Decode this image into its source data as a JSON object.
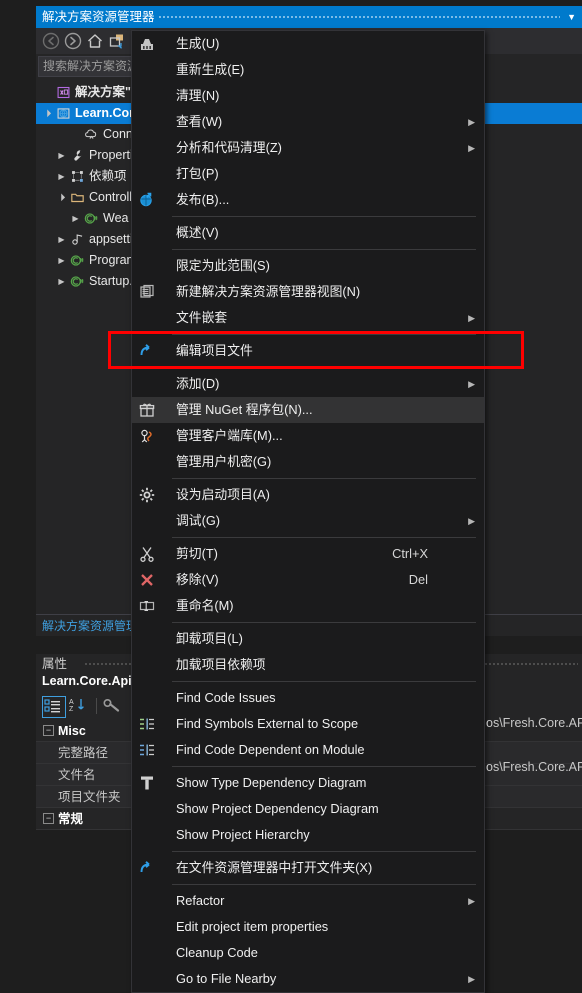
{
  "solution_explorer": {
    "title": "解决方案资源管理器",
    "dropdown_icon": "chevron-down-icon",
    "toolbar": [
      {
        "name": "back-icon",
        "label": "后退"
      },
      {
        "name": "forward-icon",
        "label": "前进"
      },
      {
        "name": "home-icon",
        "label": "主页"
      },
      {
        "name": "sync-with-active-document-icon",
        "label": "与活动文档同步"
      }
    ],
    "search": {
      "placeholder": "搜索解决方案资源管理器",
      "value": "搜索解决方案资源管理器"
    },
    "tree": [
      {
        "label": "解决方案\"Fresh",
        "icon": "solution-icon",
        "indent": 0,
        "twisty": "",
        "selected": false,
        "bold": true
      },
      {
        "label": "Learn.Core.Api",
        "icon": "web-project-icon",
        "indent": 0,
        "twisty": "▲",
        "selected": true,
        "bold": true
      },
      {
        "label": "Connected",
        "icon": "connected-services-icon",
        "indent": 2,
        "twisty": "",
        "selected": false,
        "bold": false
      },
      {
        "label": "Properties",
        "icon": "wrench-icon",
        "indent": 1,
        "twisty": "▶",
        "selected": false,
        "bold": false
      },
      {
        "label": "依赖项",
        "icon": "dependencies-icon",
        "indent": 1,
        "twisty": "▶",
        "selected": false,
        "bold": false
      },
      {
        "label": "Controllers",
        "icon": "folder-icon",
        "indent": 1,
        "twisty": "▲",
        "selected": false,
        "bold": false
      },
      {
        "label": "Wea",
        "icon": "csharp-icon",
        "indent": 2,
        "twisty": "▶",
        "selected": false,
        "bold": false
      },
      {
        "label": "appsettings.json",
        "icon": "json-icon",
        "indent": 1,
        "twisty": "▶",
        "selected": false,
        "bold": false
      },
      {
        "label": "Program.cs",
        "icon": "csharp-icon",
        "indent": 1,
        "twisty": "▶",
        "selected": false,
        "bold": false
      },
      {
        "label": "Startup.cs",
        "icon": "csharp-icon",
        "indent": 1,
        "twisty": "▶",
        "selected": false,
        "bold": false
      }
    ],
    "footer_tab": "解决方案资源管理器"
  },
  "properties": {
    "title": "属性",
    "subtitle": "Learn.Core.Api",
    "toolbar": [
      {
        "name": "categorized-icon",
        "label": "分类"
      },
      {
        "name": "alphabetical-sort-icon",
        "label": "按字母顺序"
      },
      {
        "name": "property-pages-icon",
        "label": "属性页"
      }
    ],
    "rows": [
      {
        "kind": "category",
        "name": "Misc",
        "value": ""
      },
      {
        "kind": "property",
        "name": "完整路径",
        "value": "os\\Fresh.Core.API"
      },
      {
        "kind": "property",
        "name": "文件名",
        "value": ""
      },
      {
        "kind": "property",
        "name": "项目文件夹",
        "value": "os\\Fresh.Core.API"
      },
      {
        "kind": "category",
        "name": "常规",
        "value": ""
      }
    ]
  },
  "context_menu": {
    "items": [
      {
        "type": "item",
        "label": "生成(U)",
        "icon": "build-icon",
        "shortcut": "",
        "submenu": false,
        "highlighted": false
      },
      {
        "type": "item",
        "label": "重新生成(E)",
        "icon": "",
        "shortcut": "",
        "submenu": false,
        "highlighted": false
      },
      {
        "type": "item",
        "label": "清理(N)",
        "icon": "",
        "shortcut": "",
        "submenu": false,
        "highlighted": false
      },
      {
        "type": "item",
        "label": "查看(W)",
        "icon": "",
        "shortcut": "",
        "submenu": true,
        "highlighted": false
      },
      {
        "type": "item",
        "label": "分析和代码清理(Z)",
        "icon": "",
        "shortcut": "",
        "submenu": true,
        "highlighted": false
      },
      {
        "type": "item",
        "label": "打包(P)",
        "icon": "",
        "shortcut": "",
        "submenu": false,
        "highlighted": false
      },
      {
        "type": "item",
        "label": "发布(B)...",
        "icon": "publish-icon",
        "shortcut": "",
        "submenu": false,
        "highlighted": false
      },
      {
        "type": "separator"
      },
      {
        "type": "item",
        "label": "概述(V)",
        "icon": "",
        "shortcut": "",
        "submenu": false,
        "highlighted": false
      },
      {
        "type": "separator"
      },
      {
        "type": "item",
        "label": "限定为此范围(S)",
        "icon": "",
        "shortcut": "",
        "submenu": false,
        "highlighted": false
      },
      {
        "type": "item",
        "label": "新建解决方案资源管理器视图(N)",
        "icon": "new-solution-explorer-view-icon",
        "shortcut": "",
        "submenu": false,
        "highlighted": false
      },
      {
        "type": "item",
        "label": "文件嵌套",
        "icon": "",
        "shortcut": "",
        "submenu": true,
        "highlighted": false
      },
      {
        "type": "separator"
      },
      {
        "type": "item",
        "label": "编辑项目文件",
        "icon": "edit-project-file-icon",
        "shortcut": "",
        "submenu": false,
        "highlighted": false
      },
      {
        "type": "separator"
      },
      {
        "type": "item",
        "label": "添加(D)",
        "icon": "",
        "shortcut": "",
        "submenu": true,
        "highlighted": false
      },
      {
        "type": "item",
        "label": "管理 NuGet 程序包(N)...",
        "icon": "nuget-icon",
        "shortcut": "",
        "submenu": false,
        "highlighted": true
      },
      {
        "type": "item",
        "label": "管理客户端库(M)...",
        "icon": "client-library-icon",
        "shortcut": "",
        "submenu": false,
        "highlighted": false
      },
      {
        "type": "item",
        "label": "管理用户机密(G)",
        "icon": "",
        "shortcut": "",
        "submenu": false,
        "highlighted": false
      },
      {
        "type": "separator"
      },
      {
        "type": "item",
        "label": "设为启动项目(A)",
        "icon": "gear-icon",
        "shortcut": "",
        "submenu": false,
        "highlighted": false
      },
      {
        "type": "item",
        "label": "调试(G)",
        "icon": "",
        "shortcut": "",
        "submenu": true,
        "highlighted": false
      },
      {
        "type": "separator"
      },
      {
        "type": "item",
        "label": "剪切(T)",
        "icon": "cut-icon",
        "shortcut": "Ctrl+X",
        "submenu": false,
        "highlighted": false
      },
      {
        "type": "item",
        "label": "移除(V)",
        "icon": "remove-x-icon",
        "shortcut": "Del",
        "submenu": false,
        "highlighted": false
      },
      {
        "type": "item",
        "label": "重命名(M)",
        "icon": "rename-icon",
        "shortcut": "",
        "submenu": false,
        "highlighted": false
      },
      {
        "type": "separator"
      },
      {
        "type": "item",
        "label": "卸载项目(L)",
        "icon": "",
        "shortcut": "",
        "submenu": false,
        "highlighted": false
      },
      {
        "type": "item",
        "label": "加载项目依赖项",
        "icon": "",
        "shortcut": "",
        "submenu": false,
        "highlighted": false
      },
      {
        "type": "separator"
      },
      {
        "type": "item",
        "label": "Find Code Issues",
        "icon": "",
        "shortcut": "",
        "submenu": false,
        "highlighted": false
      },
      {
        "type": "item",
        "label": "Find Symbols External to Scope",
        "icon": "find-symbols-icon",
        "shortcut": "",
        "submenu": false,
        "highlighted": false
      },
      {
        "type": "item",
        "label": "Find Code Dependent on Module",
        "icon": "find-dependent-icon",
        "shortcut": "",
        "submenu": false,
        "highlighted": false
      },
      {
        "type": "separator"
      },
      {
        "type": "item",
        "label": "Show Type Dependency Diagram",
        "icon": "type-diagram-icon",
        "shortcut": "",
        "submenu": false,
        "highlighted": false
      },
      {
        "type": "item",
        "label": "Show Project Dependency Diagram",
        "icon": "",
        "shortcut": "",
        "submenu": false,
        "highlighted": false
      },
      {
        "type": "item",
        "label": "Show Project Hierarchy",
        "icon": "",
        "shortcut": "",
        "submenu": false,
        "highlighted": false
      },
      {
        "type": "separator"
      },
      {
        "type": "item",
        "label": "在文件资源管理器中打开文件夹(X)",
        "icon": "open-folder-icon",
        "shortcut": "",
        "submenu": false,
        "highlighted": false
      },
      {
        "type": "separator"
      },
      {
        "type": "item",
        "label": "Refactor",
        "icon": "",
        "shortcut": "",
        "submenu": true,
        "highlighted": false
      },
      {
        "type": "item",
        "label": "Edit project item properties",
        "icon": "",
        "shortcut": "",
        "submenu": false,
        "highlighted": false
      },
      {
        "type": "item",
        "label": "Cleanup Code",
        "icon": "",
        "shortcut": "",
        "submenu": false,
        "highlighted": false
      },
      {
        "type": "item",
        "label": "Go to File Nearby",
        "icon": "",
        "shortcut": "",
        "submenu": true,
        "highlighted": false
      }
    ]
  },
  "annotation": {
    "name": "red-highlight-rectangle",
    "color": "#ff0000",
    "target": "管理 NuGet 程序包(N)..."
  },
  "colors": {
    "accent": "#007acc",
    "selection": "#0a7cd4",
    "menu_bg": "#1b1b1c",
    "highlight": "#ff0000"
  }
}
